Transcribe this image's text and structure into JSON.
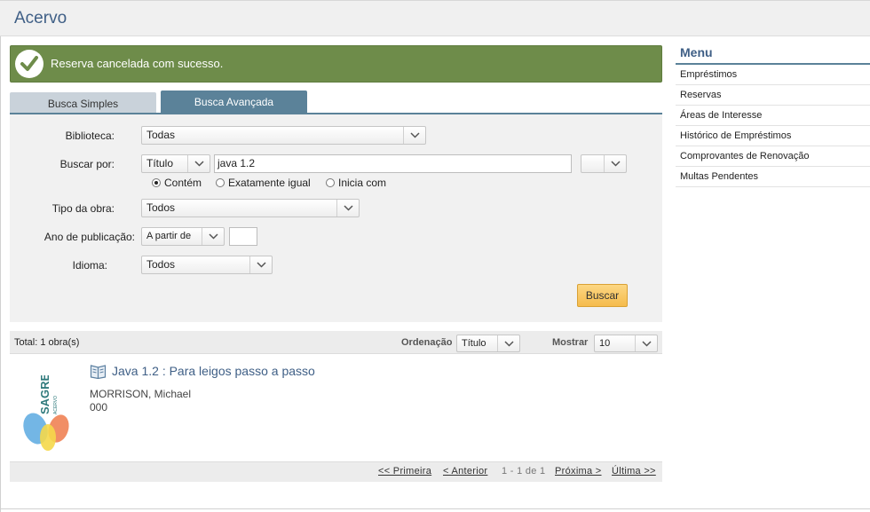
{
  "header": {
    "title": "Acervo"
  },
  "alert": {
    "message": "Reserva cancelada com sucesso.",
    "color": "#6e8c4a"
  },
  "tabs": [
    {
      "label": "Busca Simples",
      "active": false
    },
    {
      "label": "Busca Avançada",
      "active": true
    }
  ],
  "form": {
    "biblioteca": {
      "label": "Biblioteca:",
      "value": "Todas"
    },
    "buscar_por": {
      "label": "Buscar por:",
      "field": "Título",
      "query": "java 1.2",
      "extra": ""
    },
    "match_options": [
      {
        "label": "Contém",
        "selected": true
      },
      {
        "label": "Exatamente igual",
        "selected": false
      },
      {
        "label": "Inicia com",
        "selected": false
      }
    ],
    "tipo_obra": {
      "label": "Tipo da obra:",
      "value": "Todos"
    },
    "ano": {
      "label": "Ano de publicação:",
      "mode": "A partir de",
      "value": ""
    },
    "idioma": {
      "label": "Idioma:",
      "value": "Todos"
    },
    "submit_label": "Buscar"
  },
  "results": {
    "total": "Total: 1 obra(s)",
    "ordenacao_label": "Ordenação",
    "ordenacao_value": "Título",
    "mostrar_label": "Mostrar",
    "mostrar_value": "10",
    "items": [
      {
        "title": "Java 1.2 : Para leigos passo a passo",
        "author": "MORRISON, Michael",
        "code": "000",
        "logo_text": "SAGRES",
        "logo_sub": "ACERVO"
      }
    ]
  },
  "pager": {
    "first": "<< Primeira",
    "prev": "< Anterior",
    "info": "1 - 1 de 1",
    "next": "Próxima >",
    "last": "Última >>"
  },
  "menu": {
    "title": "Menu",
    "items": [
      "Empréstimos",
      "Reservas",
      "Áreas de Interesse",
      "Histórico de Empréstimos",
      "Comprovantes de Renovação",
      "Multas Pendentes"
    ]
  }
}
